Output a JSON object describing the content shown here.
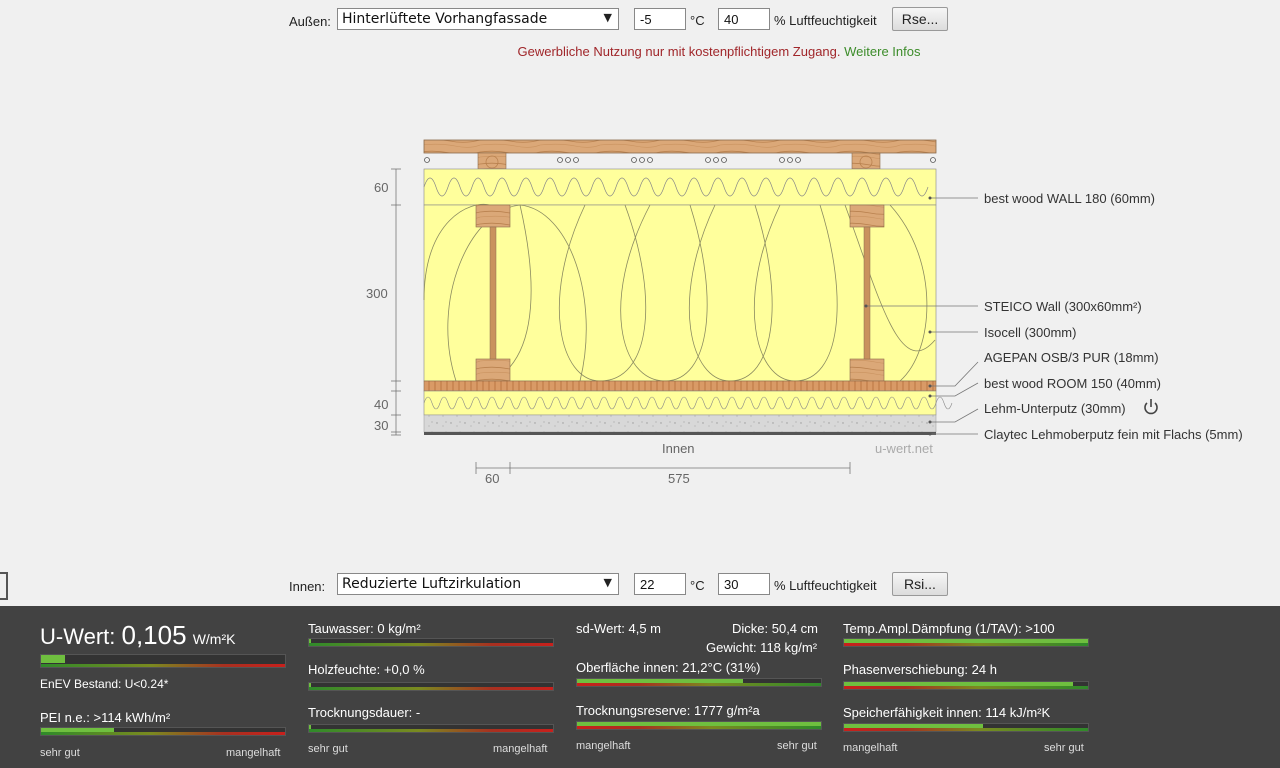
{
  "outer": {
    "label": "Außen:",
    "select_value": "Hinterlüftete Vorhangfassade",
    "temp": "-5",
    "temp_unit": "°C",
    "humidity": "40",
    "humidity_unit": "% Luftfeuchtigkeit",
    "button": "Rse..."
  },
  "notice": {
    "text": "Gewerbliche Nutzung nur mit kostenpflichtigem Zugang.",
    "link": "Weitere Infos"
  },
  "diagram": {
    "layers": [
      "best wood WALL 180 (60mm)",
      "STEICO  Wall (300x60mm²)",
      "Isocell (300mm)",
      "AGEPAN OSB/3 PUR (18mm)",
      "best wood ROOM 150 (40mm)",
      "Lehm-Unterputz (30mm)",
      "Claytec Lehmoberputz fein mit Flachs (5mm)"
    ],
    "dims_left": [
      "60",
      "300",
      "40",
      "30"
    ],
    "dims_bottom": [
      "60",
      "575"
    ],
    "inner_label": "Innen",
    "watermark": "u-wert.net"
  },
  "inner": {
    "label": "Innen:",
    "select_value": "Reduzierte Luftzirkulation",
    "temp": "22",
    "temp_unit": "°C",
    "humidity": "30",
    "humidity_unit": "% Luftfeuchtigkeit",
    "button": "Rsi..."
  },
  "results": {
    "uwert_label": "U-Wert:",
    "uwert_value": "0,105",
    "uwert_unit": "W/m²K",
    "uwert_fill": 0.1,
    "enev": "EnEV Bestand: U<0.24*",
    "pei": "PEI n.e.: >114 kWh/m²",
    "pei_fill": 0.3,
    "sehr_gut": "sehr gut",
    "mangelhaft": "mangelhaft",
    "tauwasser": "Tauwasser: 0 kg/m²",
    "tauwasser_fill": 0.0,
    "holzfeuchte": "Holzfeuchte: +0,0 %",
    "holzfeuchte_fill": 0.0,
    "trocknungsdauer": "Trocknungsdauer: -",
    "trocknungsdauer_fill": 0.0,
    "sd_wert": "sd-Wert: 4,5 m",
    "dicke": "Dicke: 50,4 cm",
    "gewicht": "Gewicht: 118 kg/m²",
    "oberflaeche": "Oberfläche innen: 21,2°C (31%)",
    "oberflaeche_fill": 0.68,
    "trocknungsreserve": "Trocknungsreserve: 1777 g/m²a",
    "trocknungsreserve_fill": 1.0,
    "temp_ampl": "Temp.Ampl.Dämpfung (1/TAV): >100",
    "temp_ampl_fill": 1.0,
    "phasen": "Phasenverschiebung: 24 h",
    "phasen_fill": 0.94,
    "speicher": "Speicherfähigkeit innen: 114 kJ/m²K",
    "speicher_fill": 0.57
  },
  "colors": {
    "bar_fill": "#6fbf3f",
    "panel_bg": "#424242",
    "insulation": "#ffff9c",
    "wood": "#d9a06a"
  }
}
